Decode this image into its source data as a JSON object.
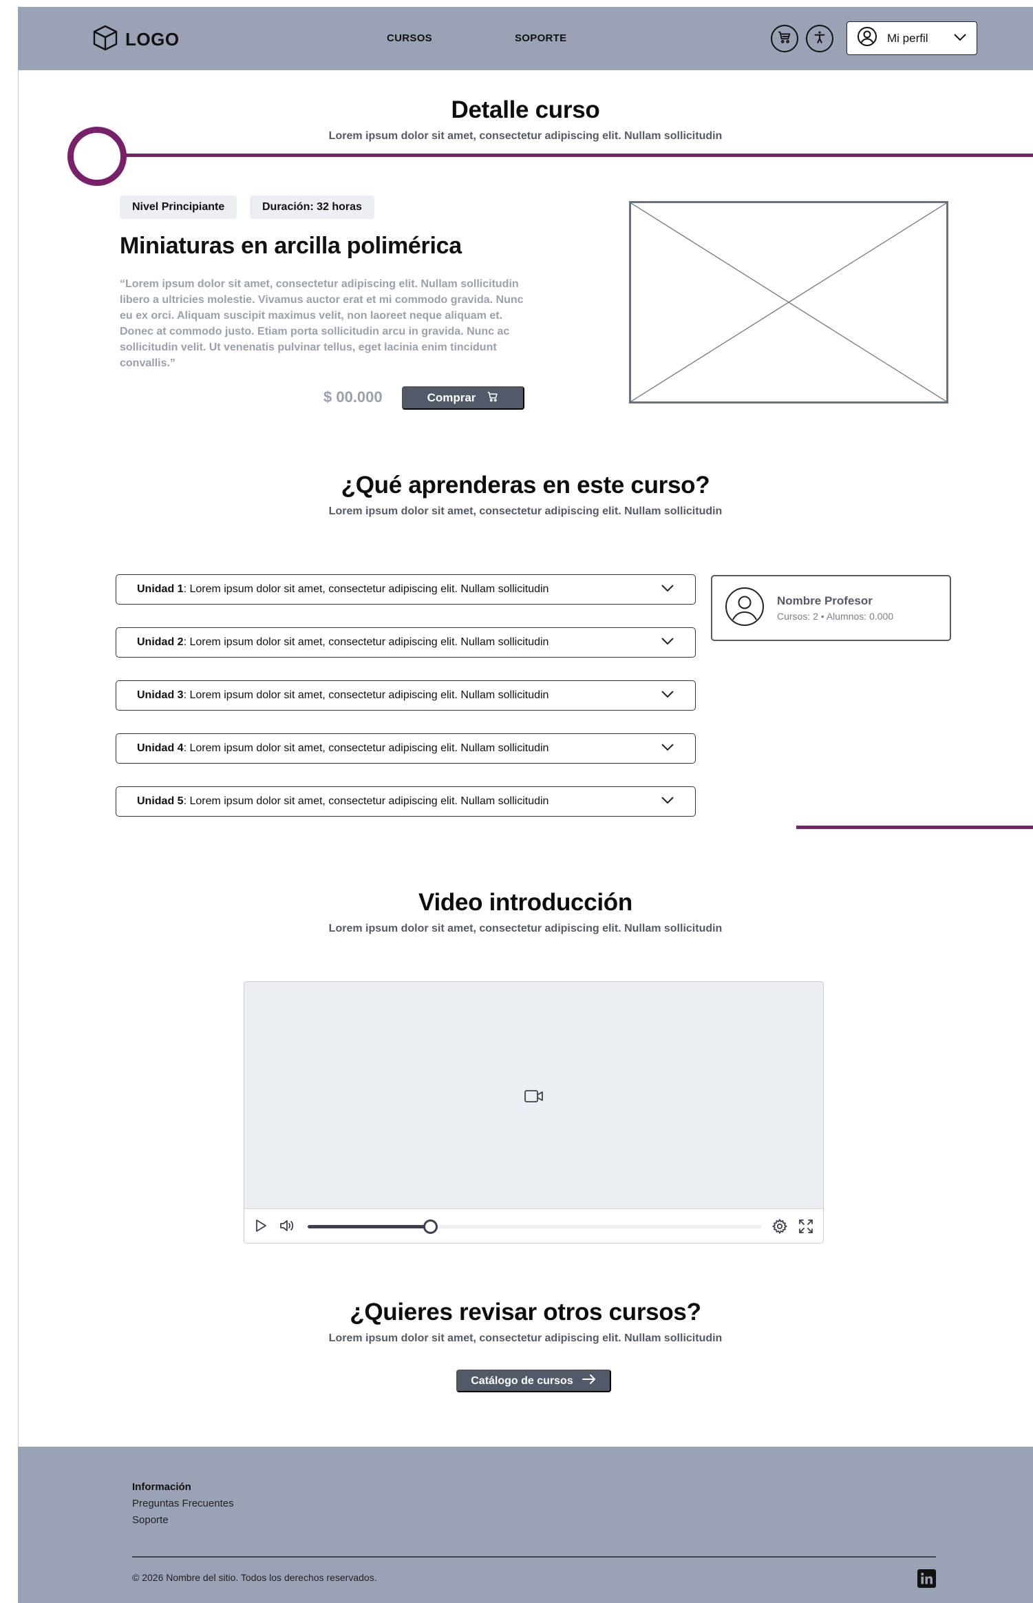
{
  "header": {
    "logo_text": "LOGO",
    "nav": [
      {
        "label": "CURSOS"
      },
      {
        "label": "SOPORTE"
      }
    ],
    "icons": [
      "cart-icon",
      "accessibility-icon"
    ],
    "profile_label": "Mi perfil"
  },
  "detail": {
    "title": "Detalle curso",
    "subtitle": "Lorem ipsum dolor sit amet, consectetur adipiscing elit. Nullam sollicitudin"
  },
  "course": {
    "badges": [
      "Nivel Principiante",
      "Duración: 32 horas"
    ],
    "title": "Miniaturas en arcilla polimérica",
    "description": "“Lorem ipsum dolor sit amet, consectetur adipiscing elit. Nullam sollicitudin libero a ultricies molestie. Vivamus auctor erat et mi commodo gravida. Nunc eu ex orci. Aliquam suscipit maximus velit, non laoreet neque aliquam et. Donec at commodo justo. Etiam porta sollicitudin arcu in gravida. Nunc ac sollicitudin velit. Ut venenatis pulvinar tellus, eget lacinia enim tincidunt convallis.”",
    "price": "$ 00.000",
    "buy_label": "Comprar"
  },
  "learn": {
    "title": "¿Qué aprenderas en este curso?",
    "subtitle": "Lorem ipsum dolor sit amet, consectetur adipiscing elit. Nullam sollicitudin",
    "units": [
      {
        "label": "Unidad 1",
        "text": ": Lorem ipsum dolor sit amet, consectetur adipiscing elit. Nullam sollicitudin"
      },
      {
        "label": "Unidad 2",
        "text": ": Lorem ipsum dolor sit amet, consectetur adipiscing elit. Nullam sollicitudin"
      },
      {
        "label": "Unidad 3",
        "text": ": Lorem ipsum dolor sit amet, consectetur adipiscing elit. Nullam sollicitudin"
      },
      {
        "label": "Unidad 4",
        "text": ": Lorem ipsum dolor sit amet, consectetur adipiscing elit. Nullam sollicitudin"
      },
      {
        "label": "Unidad 5",
        "text": ": Lorem ipsum dolor sit amet, consectetur adipiscing elit. Nullam sollicitudin"
      }
    ],
    "professor": {
      "name": "Nombre Profesor",
      "stats": "Cursos: 2 • Alumnos: 0.000"
    }
  },
  "video": {
    "title": "Video introducción",
    "subtitle": "Lorem ipsum dolor sit amet, consectetur adipiscing elit. Nullam sollicitudin",
    "progress_percent": 27
  },
  "others": {
    "title": "¿Quieres revisar otros cursos?",
    "subtitle": "Lorem ipsum dolor sit amet, consectetur adipiscing elit. Nullam sollicitudin",
    "button_label": "Catálogo de cursos"
  },
  "footer": {
    "heading": "Información",
    "links": [
      "Preguntas Frecuentes",
      "Soporte"
    ],
    "copyright": "© 2026 Nombre del sitio. Todos los derechos reservados."
  },
  "colors": {
    "header_bg": "#9ca2b5",
    "accent": "#78206a",
    "button_bg": "#525a6a"
  }
}
